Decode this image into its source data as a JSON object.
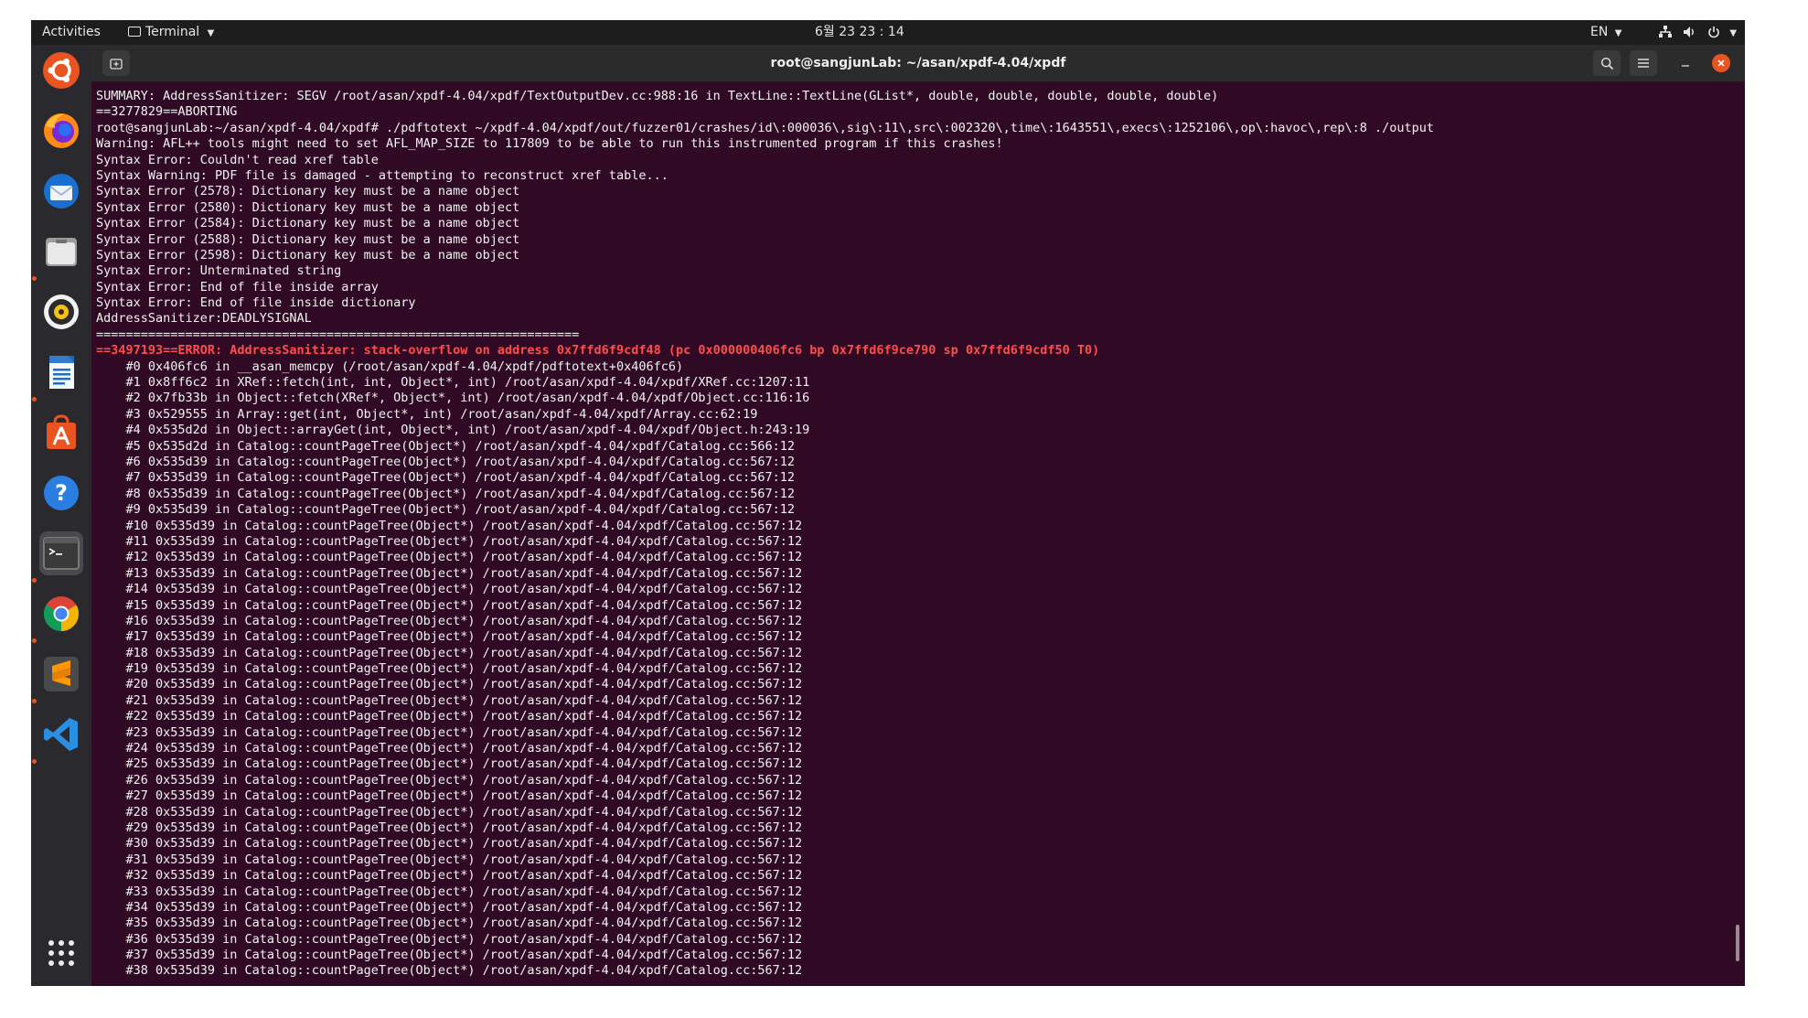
{
  "topbar": {
    "activities": "Activities",
    "app_menu": "Terminal",
    "clock": "6월 23  23 : 14",
    "language": "EN"
  },
  "dock": {
    "items": [
      {
        "name": "ubuntu",
        "running": false
      },
      {
        "name": "firefox",
        "running": false
      },
      {
        "name": "thunderbird",
        "running": false
      },
      {
        "name": "files",
        "running": true
      },
      {
        "name": "rhythmbox",
        "running": false
      },
      {
        "name": "libreoffice-writer",
        "running": true
      },
      {
        "name": "software",
        "running": false
      },
      {
        "name": "help",
        "running": false
      },
      {
        "name": "terminal",
        "running": true,
        "active": true
      },
      {
        "name": "chrome",
        "running": true
      },
      {
        "name": "sublime-text",
        "running": true
      },
      {
        "name": "vscode",
        "running": true
      }
    ],
    "apps_grid": "show-applications"
  },
  "window": {
    "title": "root@sangjunLab: ~/asan/xpdf-4.04/xpdf"
  },
  "terminal": {
    "lines": [
      {
        "text": "SUMMARY: AddressSanitizer: SEGV /root/asan/xpdf-4.04/xpdf/TextOutputDev.cc:988:16 in TextLine::TextLine(GList*, double, double, double, double, double)"
      },
      {
        "text": "==3277829==ABORTING"
      },
      {
        "text": "root@sangjunLab:~/asan/xpdf-4.04/xpdf# ./pdftotext ~/xpdf-4.04/xpdf/out/fuzzer01/crashes/id\\:000036\\,sig\\:11\\,src\\:002320\\,time\\:1643551\\,execs\\:1252106\\,op\\:havoc\\,rep\\:8 ./output"
      },
      {
        "text": "Warning: AFL++ tools might need to set AFL_MAP_SIZE to 117809 to be able to run this instrumented program if this crashes!"
      },
      {
        "text": "Syntax Error: Couldn't read xref table"
      },
      {
        "text": "Syntax Warning: PDF file is damaged - attempting to reconstruct xref table..."
      },
      {
        "text": "Syntax Error (2578): Dictionary key must be a name object"
      },
      {
        "text": "Syntax Error (2580): Dictionary key must be a name object"
      },
      {
        "text": "Syntax Error (2584): Dictionary key must be a name object"
      },
      {
        "text": "Syntax Error (2588): Dictionary key must be a name object"
      },
      {
        "text": "Syntax Error (2598): Dictionary key must be a name object"
      },
      {
        "text": "Syntax Error: Unterminated string"
      },
      {
        "text": "Syntax Error: End of file inside array"
      },
      {
        "text": "Syntax Error: End of file inside dictionary"
      },
      {
        "text": "AddressSanitizer:DEADLYSIGNAL"
      },
      {
        "text": "================================================================="
      },
      {
        "text": "==3497193==ERROR: AddressSanitizer: stack-overflow on address 0x7ffd6f9cdf48 (pc 0x000000406fc6 bp 0x7ffd6f9ce790 sp 0x7ffd6f9cdf50 T0)",
        "error": true
      },
      {
        "text": "    #0 0x406fc6 in __asan_memcpy (/root/asan/xpdf-4.04/xpdf/pdftotext+0x406fc6)"
      },
      {
        "text": "    #1 0x8ff6c2 in XRef::fetch(int, int, Object*, int) /root/asan/xpdf-4.04/xpdf/XRef.cc:1207:11"
      },
      {
        "text": "    #2 0x7fb33b in Object::fetch(XRef*, Object*, int) /root/asan/xpdf-4.04/xpdf/Object.cc:116:16"
      },
      {
        "text": "    #3 0x529555 in Array::get(int, Object*, int) /root/asan/xpdf-4.04/xpdf/Array.cc:62:19"
      },
      {
        "text": "    #4 0x535d2d in Object::arrayGet(int, Object*, int) /root/asan/xpdf-4.04/xpdf/Object.h:243:19"
      },
      {
        "text": "    #5 0x535d2d in Catalog::countPageTree(Object*) /root/asan/xpdf-4.04/xpdf/Catalog.cc:566:12"
      },
      {
        "text": "    #6 0x535d39 in Catalog::countPageTree(Object*) /root/asan/xpdf-4.04/xpdf/Catalog.cc:567:12"
      },
      {
        "text": "    #7 0x535d39 in Catalog::countPageTree(Object*) /root/asan/xpdf-4.04/xpdf/Catalog.cc:567:12"
      },
      {
        "text": "    #8 0x535d39 in Catalog::countPageTree(Object*) /root/asan/xpdf-4.04/xpdf/Catalog.cc:567:12"
      },
      {
        "text": "    #9 0x535d39 in Catalog::countPageTree(Object*) /root/asan/xpdf-4.04/xpdf/Catalog.cc:567:12"
      },
      {
        "text": "    #10 0x535d39 in Catalog::countPageTree(Object*) /root/asan/xpdf-4.04/xpdf/Catalog.cc:567:12"
      },
      {
        "text": "    #11 0x535d39 in Catalog::countPageTree(Object*) /root/asan/xpdf-4.04/xpdf/Catalog.cc:567:12"
      },
      {
        "text": "    #12 0x535d39 in Catalog::countPageTree(Object*) /root/asan/xpdf-4.04/xpdf/Catalog.cc:567:12"
      },
      {
        "text": "    #13 0x535d39 in Catalog::countPageTree(Object*) /root/asan/xpdf-4.04/xpdf/Catalog.cc:567:12"
      },
      {
        "text": "    #14 0x535d39 in Catalog::countPageTree(Object*) /root/asan/xpdf-4.04/xpdf/Catalog.cc:567:12"
      },
      {
        "text": "    #15 0x535d39 in Catalog::countPageTree(Object*) /root/asan/xpdf-4.04/xpdf/Catalog.cc:567:12"
      },
      {
        "text": "    #16 0x535d39 in Catalog::countPageTree(Object*) /root/asan/xpdf-4.04/xpdf/Catalog.cc:567:12"
      },
      {
        "text": "    #17 0x535d39 in Catalog::countPageTree(Object*) /root/asan/xpdf-4.04/xpdf/Catalog.cc:567:12"
      },
      {
        "text": "    #18 0x535d39 in Catalog::countPageTree(Object*) /root/asan/xpdf-4.04/xpdf/Catalog.cc:567:12"
      },
      {
        "text": "    #19 0x535d39 in Catalog::countPageTree(Object*) /root/asan/xpdf-4.04/xpdf/Catalog.cc:567:12"
      },
      {
        "text": "    #20 0x535d39 in Catalog::countPageTree(Object*) /root/asan/xpdf-4.04/xpdf/Catalog.cc:567:12"
      },
      {
        "text": "    #21 0x535d39 in Catalog::countPageTree(Object*) /root/asan/xpdf-4.04/xpdf/Catalog.cc:567:12"
      },
      {
        "text": "    #22 0x535d39 in Catalog::countPageTree(Object*) /root/asan/xpdf-4.04/xpdf/Catalog.cc:567:12"
      },
      {
        "text": "    #23 0x535d39 in Catalog::countPageTree(Object*) /root/asan/xpdf-4.04/xpdf/Catalog.cc:567:12"
      },
      {
        "text": "    #24 0x535d39 in Catalog::countPageTree(Object*) /root/asan/xpdf-4.04/xpdf/Catalog.cc:567:12"
      },
      {
        "text": "    #25 0x535d39 in Catalog::countPageTree(Object*) /root/asan/xpdf-4.04/xpdf/Catalog.cc:567:12"
      },
      {
        "text": "    #26 0x535d39 in Catalog::countPageTree(Object*) /root/asan/xpdf-4.04/xpdf/Catalog.cc:567:12"
      },
      {
        "text": "    #27 0x535d39 in Catalog::countPageTree(Object*) /root/asan/xpdf-4.04/xpdf/Catalog.cc:567:12"
      },
      {
        "text": "    #28 0x535d39 in Catalog::countPageTree(Object*) /root/asan/xpdf-4.04/xpdf/Catalog.cc:567:12"
      },
      {
        "text": "    #29 0x535d39 in Catalog::countPageTree(Object*) /root/asan/xpdf-4.04/xpdf/Catalog.cc:567:12"
      },
      {
        "text": "    #30 0x535d39 in Catalog::countPageTree(Object*) /root/asan/xpdf-4.04/xpdf/Catalog.cc:567:12"
      },
      {
        "text": "    #31 0x535d39 in Catalog::countPageTree(Object*) /root/asan/xpdf-4.04/xpdf/Catalog.cc:567:12"
      },
      {
        "text": "    #32 0x535d39 in Catalog::countPageTree(Object*) /root/asan/xpdf-4.04/xpdf/Catalog.cc:567:12"
      },
      {
        "text": "    #33 0x535d39 in Catalog::countPageTree(Object*) /root/asan/xpdf-4.04/xpdf/Catalog.cc:567:12"
      },
      {
        "text": "    #34 0x535d39 in Catalog::countPageTree(Object*) /root/asan/xpdf-4.04/xpdf/Catalog.cc:567:12"
      },
      {
        "text": "    #35 0x535d39 in Catalog::countPageTree(Object*) /root/asan/xpdf-4.04/xpdf/Catalog.cc:567:12"
      },
      {
        "text": "    #36 0x535d39 in Catalog::countPageTree(Object*) /root/asan/xpdf-4.04/xpdf/Catalog.cc:567:12"
      },
      {
        "text": "    #37 0x535d39 in Catalog::countPageTree(Object*) /root/asan/xpdf-4.04/xpdf/Catalog.cc:567:12"
      },
      {
        "text": "    #38 0x535d39 in Catalog::countPageTree(Object*) /root/asan/xpdf-4.04/xpdf/Catalog.cc:567:12"
      }
    ]
  },
  "colors": {
    "terminal_bg": "#300a24",
    "terminal_fg": "#f2f2f2",
    "error_fg": "#ff4d4d",
    "accent": "#e95420",
    "close_button": "#e95420"
  }
}
